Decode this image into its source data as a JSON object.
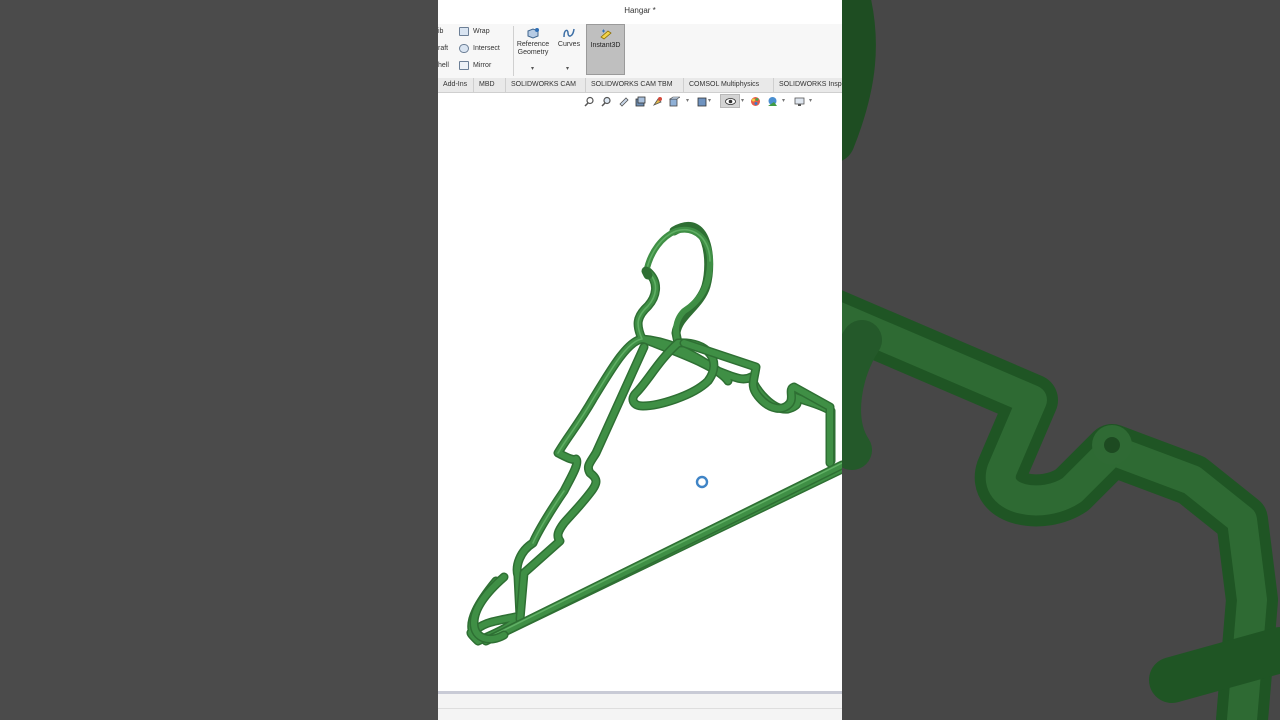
{
  "window": {
    "title": "Hangar *"
  },
  "ribbon": {
    "col1": [
      "ib",
      "raft",
      "hell"
    ],
    "col2": [
      "Wrap",
      "Intersect",
      "Mirror"
    ],
    "reference_geometry": "Reference\nGeometry",
    "reference_geometry_line1": "Reference",
    "reference_geometry_line2": "Geometry",
    "curves": "Curves",
    "instant3d": "Instant3D",
    "dropdown": "▾"
  },
  "tabs": [
    "Add-Ins",
    "MBD",
    "SOLIDWORKS CAM",
    "SOLIDWORKS CAM TBM",
    "COMSOL Multiphysics",
    "SOLIDWORKS Insp"
  ],
  "heads_up_toolbar": {
    "icons": [
      "zoom-to-fit-icon",
      "zoom-to-area-icon",
      "previous-view-icon",
      "section-view-icon",
      "dynamic-annotation-icon",
      "view-orientation-icon",
      "display-style-icon",
      "hide-show-items-icon",
      "edit-appearance-icon",
      "apply-scene-icon",
      "view-settings-icon"
    ]
  },
  "model": {
    "name": "Hangar",
    "color": "#3f8f45",
    "color_dark": "#2e6f33",
    "color_light": "#69b86d"
  },
  "colors": {
    "background": "#4a4a4a",
    "viewport": "#ffffff",
    "active_button": "#bfbfbf"
  }
}
